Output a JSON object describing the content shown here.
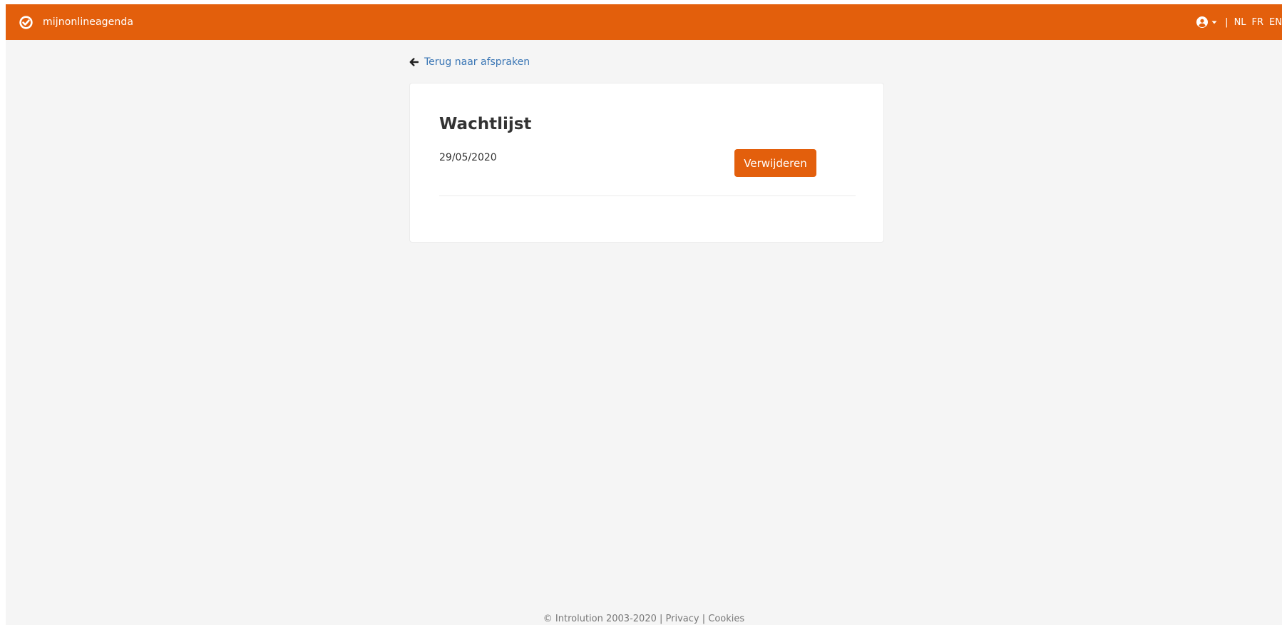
{
  "header": {
    "brand": "mijnonlineagenda",
    "separator": "|",
    "languages": [
      "NL",
      "FR",
      "EN"
    ]
  },
  "nav": {
    "back_label": "Terug naar afspraken"
  },
  "card": {
    "title": "Wachtlijst",
    "entries": [
      {
        "date": "29/05/2020",
        "delete_label": "Verwijderen"
      }
    ]
  },
  "footer": {
    "copyright": "© Introlution 2003-2020",
    "separator": "|",
    "privacy": "Privacy",
    "cookies": "Cookies"
  },
  "colors": {
    "accent": "#e35f0c",
    "link": "#3a76b5",
    "background": "#f5f5f5"
  },
  "icons": {
    "brand": "check-circle-icon",
    "user": "user-circle-icon",
    "caret": "caret-down-icon",
    "back": "arrow-left-icon"
  }
}
